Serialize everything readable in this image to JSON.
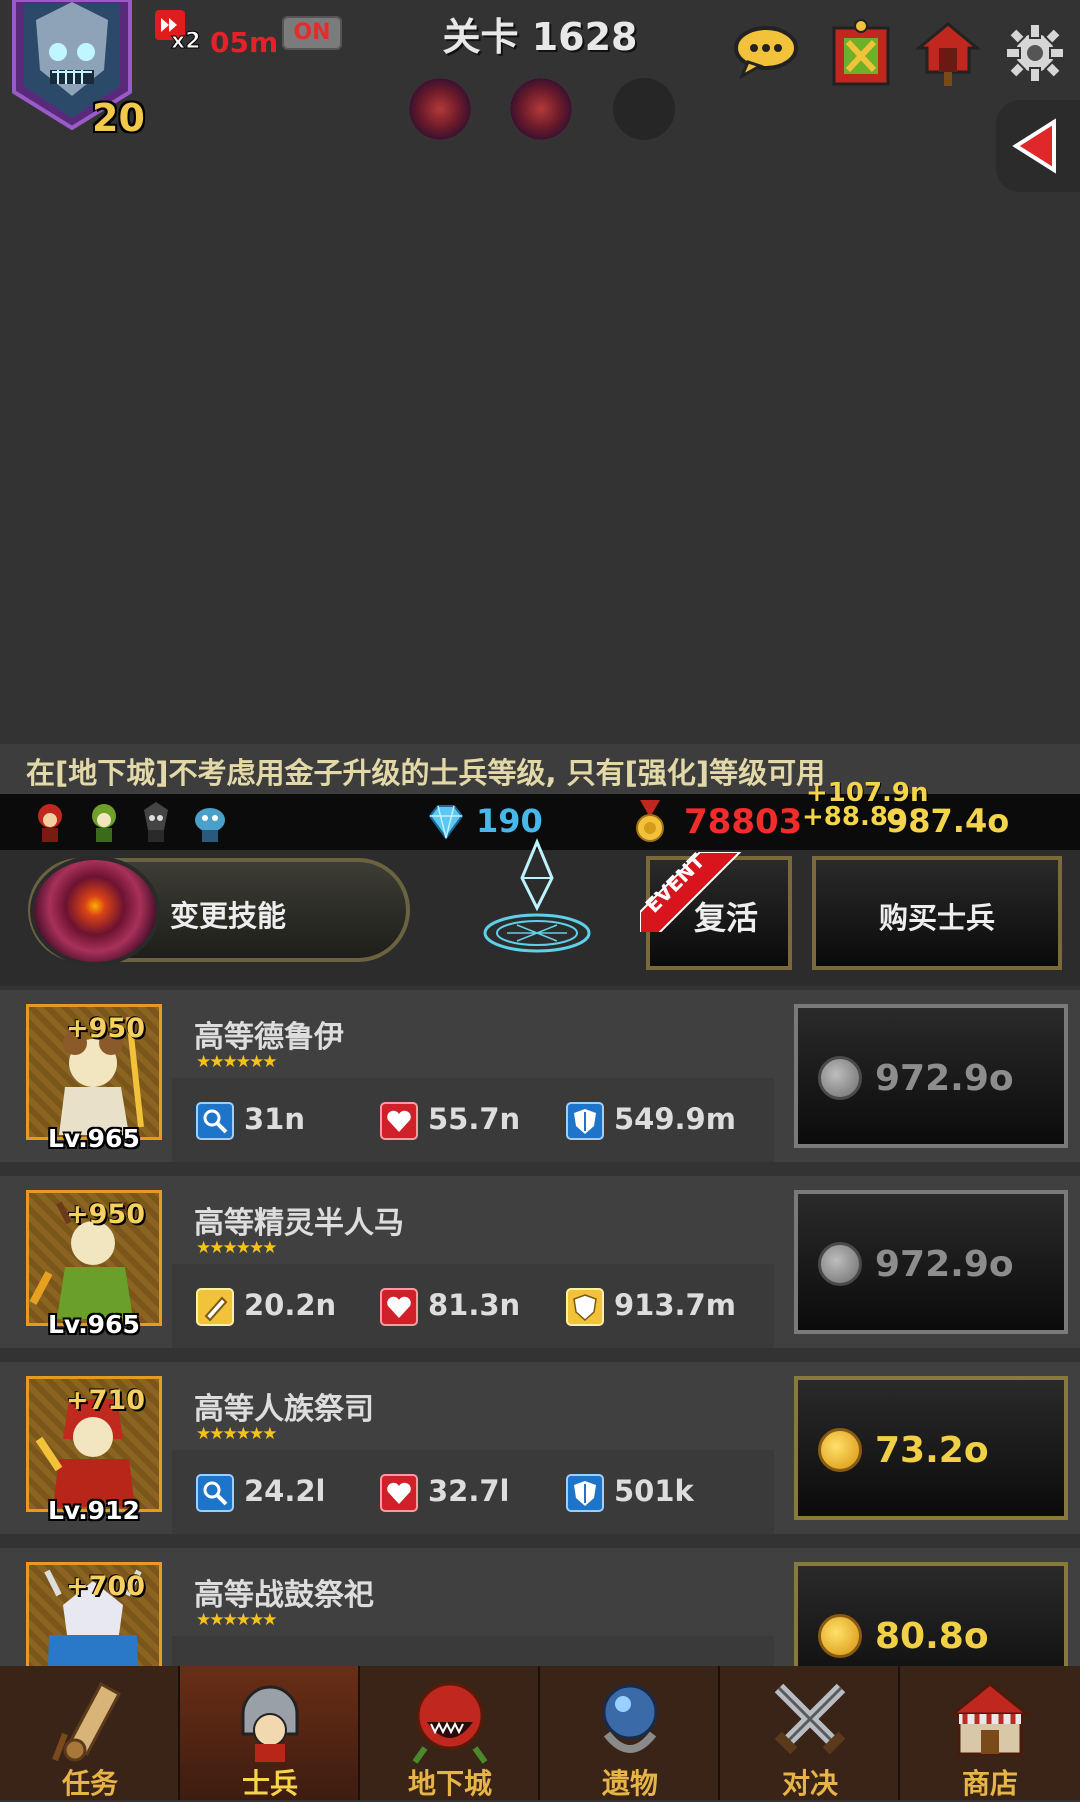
{
  "hud": {
    "player_level": "20",
    "speed_multiplier": "x2",
    "speed_timer": "05m",
    "speed_toggle": "ON",
    "stage_label": "关卡 1628"
  },
  "tip_text": "在[地下城]不考虑用金子升级的士兵等级, 只有[强化]等级可用",
  "resources": {
    "gems": "190",
    "medals": "78803",
    "gold": "987.4o",
    "gain_popups": [
      "+107.9n",
      "+88.8o"
    ]
  },
  "actions": {
    "change_skill_label": "变更技能",
    "event_badge": "EVENT",
    "revive_label": "复活",
    "buy_soldier_label": "购买士兵"
  },
  "units": [
    {
      "name": "高等德鲁伊",
      "enhance": "+950",
      "level": "Lv.965",
      "stars": "★★★★★★",
      "atk_type": "magic",
      "atk": "31n",
      "hp": "55.7n",
      "def": "549.9m",
      "cost": "972.9o",
      "cost_state": "disabled"
    },
    {
      "name": "高等精灵半人马",
      "enhance": "+950",
      "level": "Lv.965",
      "stars": "★★★★★★",
      "atk_type": "physical",
      "atk": "20.2n",
      "hp": "81.3n",
      "def": "913.7m",
      "cost": "972.9o",
      "cost_state": "disabled"
    },
    {
      "name": "高等人族祭司",
      "enhance": "+710",
      "level": "Lv.912",
      "stars": "★★★★★★",
      "atk_type": "magic",
      "atk": "24.2l",
      "hp": "32.7l",
      "def": "501k",
      "cost": "73.2o",
      "cost_state": "active"
    },
    {
      "name": "高等战鼓祭祀",
      "enhance": "+700",
      "level": "",
      "stars": "★★★★★★",
      "atk_type": "physical",
      "atk": "",
      "hp": "",
      "def": "",
      "cost": "80.8o",
      "cost_state": "active"
    }
  ],
  "nav": [
    {
      "label": "任务",
      "icon": "scroll-icon"
    },
    {
      "label": "士兵",
      "icon": "helmet-icon"
    },
    {
      "label": "地下城",
      "icon": "monster-plant-icon"
    },
    {
      "label": "遗物",
      "icon": "orb-relic-icon"
    },
    {
      "label": "对决",
      "icon": "crossed-swords-icon"
    },
    {
      "label": "商店",
      "icon": "shop-icon"
    }
  ],
  "colors": {
    "background": "#333333",
    "gold_text": "#f3d44a",
    "gem_text": "#46b8ea",
    "medal_text": "#f22b2b",
    "nav_label": "#e7b448"
  }
}
